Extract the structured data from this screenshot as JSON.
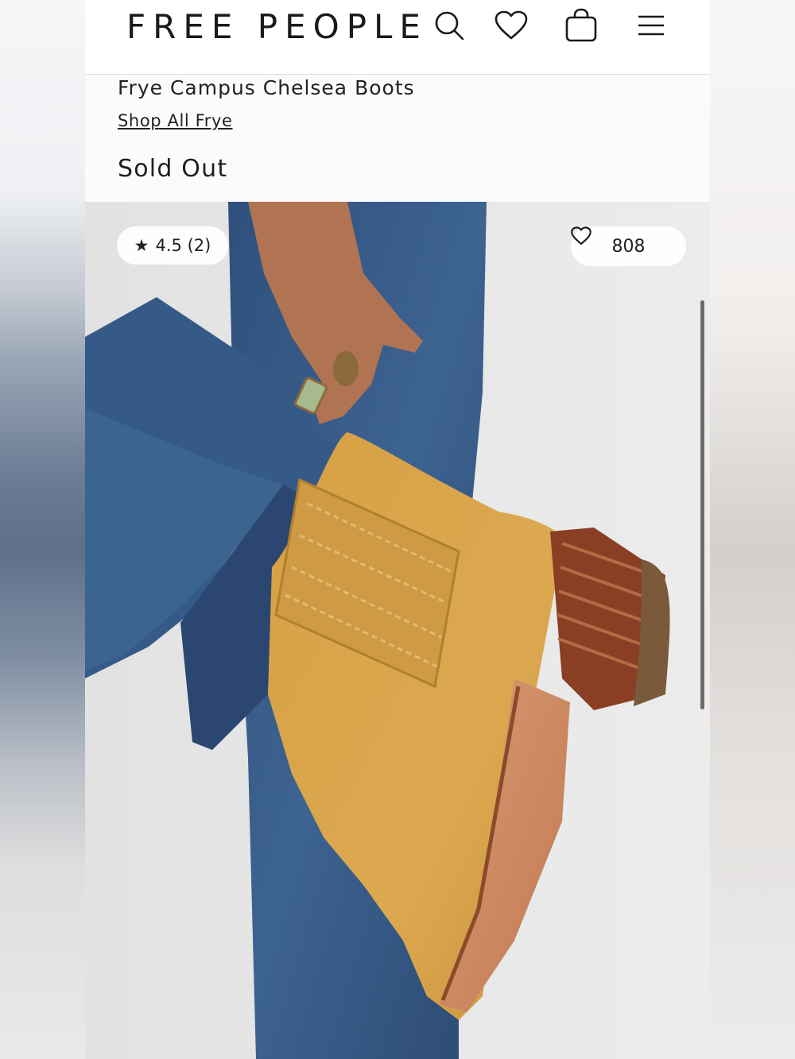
{
  "header": {
    "logo": "FREE PEOPLE",
    "icons": [
      "search-icon",
      "heart-icon",
      "shopping-bag-icon",
      "menu-icon"
    ]
  },
  "product": {
    "title": "Frye Campus Chelsea Boots",
    "shop_link": "Shop All Frye",
    "status": "Sold Out"
  },
  "image_overlay": {
    "rating_star": "★",
    "rating": "4.5 (2)",
    "likes": "808"
  },
  "colors": {
    "denim": "#3b5f8f",
    "boot_tan": "#d9a64a",
    "heel_brown": "#8a4a2e",
    "text": "#222222"
  }
}
